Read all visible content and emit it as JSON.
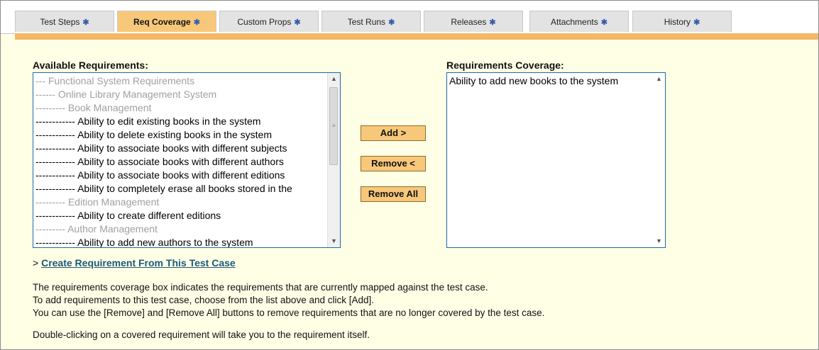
{
  "tabs": [
    {
      "label": "Test Steps",
      "marker": "✱",
      "active": false
    },
    {
      "label": "Req Coverage",
      "marker": "✱",
      "active": true
    },
    {
      "label": "Custom Props",
      "marker": "✱",
      "active": false
    },
    {
      "label": "Test Runs",
      "marker": "✱",
      "active": false
    },
    {
      "label": "Releases",
      "marker": "✱",
      "active": false
    },
    {
      "label": "Attachments",
      "marker": "✱",
      "active": false
    },
    {
      "label": "History",
      "marker": "✱",
      "active": false
    }
  ],
  "available": {
    "label": "Available Requirements:",
    "items": [
      {
        "text": "--- Functional System Requirements",
        "style": "grey"
      },
      {
        "text": "------ Online Library Management System",
        "style": "grey"
      },
      {
        "text": "--------- Book Management",
        "style": "grey"
      },
      {
        "text": "------------ Ability to edit existing books in the system",
        "style": "black"
      },
      {
        "text": "------------ Ability to delete existing books in the system",
        "style": "black"
      },
      {
        "text": "------------ Ability to associate books with different subjects",
        "style": "black"
      },
      {
        "text": "------------ Ability to associate books with different authors",
        "style": "black"
      },
      {
        "text": "------------ Ability to associate books with different editions",
        "style": "black"
      },
      {
        "text": "------------ Ability to completely erase all books stored in the",
        "style": "black"
      },
      {
        "text": "--------- Edition Management",
        "style": "grey"
      },
      {
        "text": "------------ Ability to create different editions",
        "style": "black"
      },
      {
        "text": "--------- Author Management",
        "style": "grey"
      },
      {
        "text": "------------ Ability to add new authors to the system",
        "style": "black"
      }
    ]
  },
  "buttons": {
    "add": "Add >",
    "remove": "Remove <",
    "remove_all": "Remove All"
  },
  "coverage": {
    "label": "Requirements Coverage:",
    "items": [
      "Ability to add new books to the system"
    ]
  },
  "create_link": {
    "prefix": ">",
    "text": "Create Requirement From This Test Case"
  },
  "notes": [
    "The requirements coverage box indicates the requirements that are currently mapped against the test case.",
    "To add requirements to this test case, choose from the list above and click [Add].",
    "You can use the [Remove] and [Remove All] buttons to remove requirements that are no longer covered by the test case.",
    "Double-clicking on a covered requirement will take you to the requirement itself."
  ],
  "colors": {
    "panel_bg": "#ffffe6",
    "tab_active": "#f8c87a",
    "tab_inactive": "#e3e3e3",
    "band": "#f3b765",
    "listbox_border": "#1b6aa8",
    "link": "#1b5a7a"
  },
  "icons": {
    "tab_marker": "asterisk-icon",
    "scroll_up": "scroll-up-arrow-icon",
    "scroll_down": "scroll-down-arrow-icon"
  }
}
